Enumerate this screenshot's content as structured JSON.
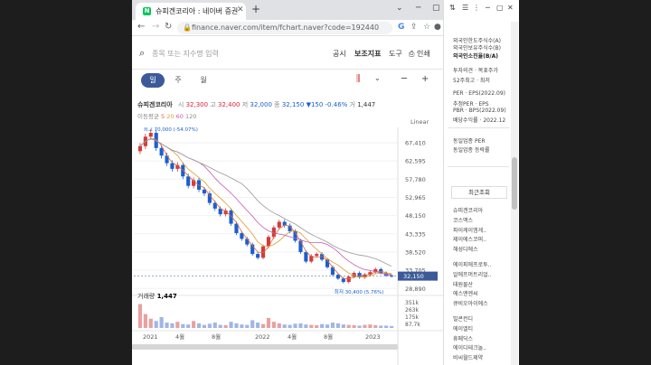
{
  "browser": {
    "tab_title": "슈피겐코리아 : 네이버 증권",
    "favicon_text": "N",
    "url": "finance.naver.com/item/fchart.naver?code=192440"
  },
  "search": {
    "placeholder": "종목 또는 지수명 입력"
  },
  "topnav": {
    "notice": "공시",
    "indicator": "보조지표",
    "tools": "도구",
    "print": "인쇄"
  },
  "periods": {
    "day": "일",
    "week": "주",
    "month": "월"
  },
  "stock": {
    "name": "슈피겐코리아",
    "open_label": "시",
    "open": "32,300",
    "high_label": "고",
    "high": "32,400",
    "low_label": "저",
    "low": "32,000",
    "close_label": "종",
    "close": "32,150",
    "change": "▼150 -0.46%",
    "vol_label": "거",
    "volume": "1,447"
  },
  "ma": {
    "label": "이동평균",
    "m5": "5",
    "m20": "20",
    "m60": "60",
    "m120": "120"
  },
  "scale_mode": "Linear",
  "colors": {
    "up": "#d23b3b",
    "down": "#1a5fd1",
    "active": "#3c5a99",
    "price_tag": "#3c5a99"
  },
  "chart_data": {
    "type": "candlestick",
    "title": "",
    "price_axis_ticks": [
      "67,410",
      "62,595",
      "57,780",
      "52,965",
      "48,150",
      "43,335",
      "38,520",
      "33,705",
      "28,890"
    ],
    "price_axis_values": [
      67410,
      62595,
      57780,
      52965,
      48150,
      43335,
      38520,
      33705,
      28890
    ],
    "x_ticks": [
      "2021",
      "4월",
      "8월",
      "2022",
      "4월",
      "8월",
      "2023"
    ],
    "ylim": [
      28000,
      70500
    ],
    "last_price_tag": "32,150",
    "max_annotation": "최고 70,000 (-54.07%)",
    "min_annotation": "최저 30,400 (5.76%)",
    "close_series": [
      66500,
      69000,
      70000,
      66000,
      64000,
      62000,
      60500,
      61500,
      58500,
      56000,
      57500,
      55000,
      54000,
      51500,
      50000,
      48500,
      49500,
      46000,
      43500,
      42000,
      40500,
      38000,
      37000,
      40000,
      42500,
      45000,
      46500,
      45500,
      44000,
      41500,
      38500,
      36000,
      37500,
      38000,
      36500,
      34500,
      32500,
      31500,
      30600,
      32000,
      33000,
      31800,
      32600,
      33200,
      34000,
      33000,
      32300,
      32150
    ],
    "volume_label": "거래량",
    "volume_value": "1,447",
    "volume_axis_ticks": [
      "351k",
      "263k",
      "175k",
      "87.7k"
    ],
    "volume_series": [
      310,
      180,
      120,
      90,
      140,
      70,
      60,
      80,
      50,
      45,
      90,
      60,
      40,
      55,
      70,
      40,
      35,
      80,
      60,
      45,
      40,
      100,
      70,
      50,
      130,
      80,
      60,
      45,
      40,
      55,
      60,
      45,
      40,
      35,
      50,
      45,
      70,
      60,
      45,
      40,
      35,
      30,
      40,
      45,
      35,
      30,
      30,
      25
    ]
  },
  "right_panel": {
    "items": [
      "외국인한도주식수(A)",
      "외국인보유주식수(B)",
      "외국인소진율(B/A)",
      "투자의견 · 목표주가",
      "52주최고 · 최저",
      "PER · EPS(2022.09)",
      "추정PER · EPS",
      "PBR · BPS(2022.09)",
      "배당수익률 · 2022.12",
      "동일업종 PER",
      "동일업종 등락률"
    ],
    "recent_header": "최근조회",
    "recent": [
      "슈피겐코리아",
      "코스맥스",
      "파이케이엠게..",
      "제이에스코퍼..",
      "해성디에스",
      "에이피에프로투..",
      "알에프머트리얼..",
      "태원물산",
      "에스엔엔씨",
      "큐비오아이에스",
      "빌콘컨디",
      "에이엘티",
      "휴메딕스",
      "에이디테크놀..",
      "비씨월드제약"
    ]
  }
}
